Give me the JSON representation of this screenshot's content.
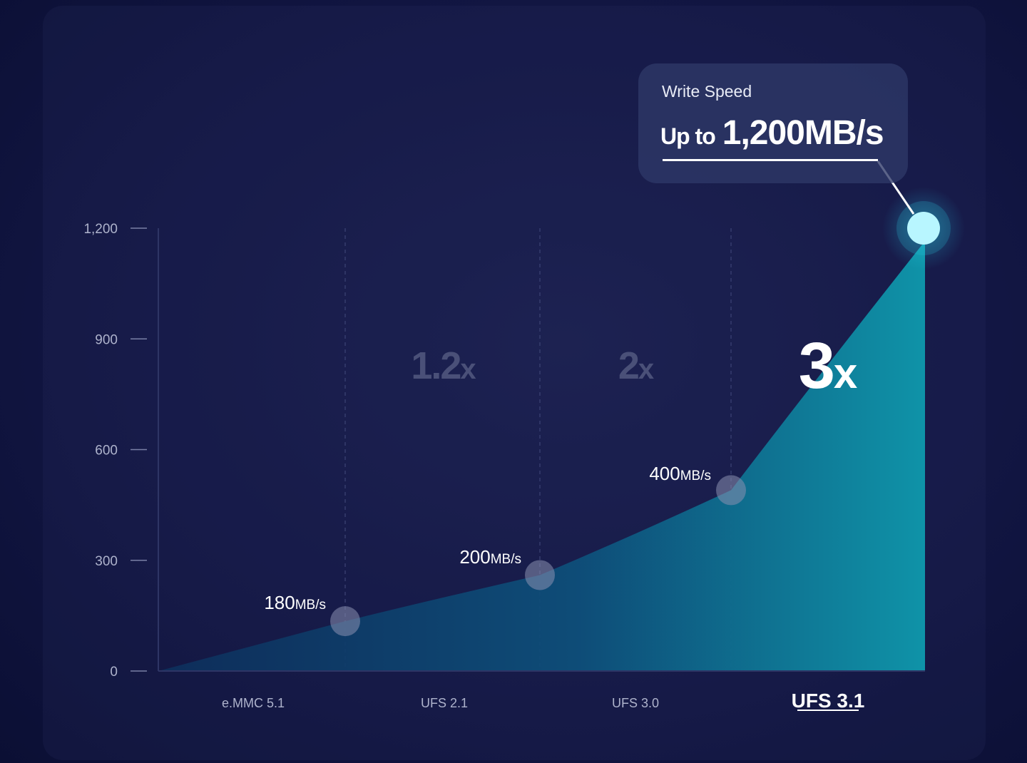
{
  "callout": {
    "label": "Write Speed",
    "prefix": "Up to",
    "value": "1,200MB/s"
  },
  "chart_data": {
    "type": "area",
    "title": "",
    "xlabel": "",
    "ylabel": "",
    "ylim": [
      0,
      1200
    ],
    "yticks": [
      "0",
      "300",
      "600",
      "900",
      "1,200"
    ],
    "ytick_values": [
      0,
      300,
      600,
      900,
      1200
    ],
    "categories": [
      "e.MMC 5.1",
      "UFS 2.1",
      "UFS 3.0",
      "UFS 3.1"
    ],
    "highlighted_category": "UFS 3.1",
    "points": [
      {
        "label_value": "180",
        "label_unit": "MB/s",
        "y": 135
      },
      {
        "label_value": "200",
        "label_unit": "MB/s",
        "y": 260
      },
      {
        "label_value": "400",
        "label_unit": "MB/s",
        "y": 490
      },
      {
        "label_value": "1,200",
        "label_unit": "MB/s",
        "y": 1200
      }
    ],
    "multipliers": [
      {
        "num": "1.2",
        "suffix": "x",
        "highlight": false
      },
      {
        "num": "2",
        "suffix": "x",
        "highlight": false
      },
      {
        "num": "3",
        "suffix": "x",
        "highlight": true
      }
    ],
    "colors": {
      "fill_light": "#0f8fa5",
      "fill_dark": "#0e3a66",
      "highlight_point": "#b8f6ff",
      "muted_text": "#4a5078",
      "axis_text": "#aeb3cc"
    }
  }
}
